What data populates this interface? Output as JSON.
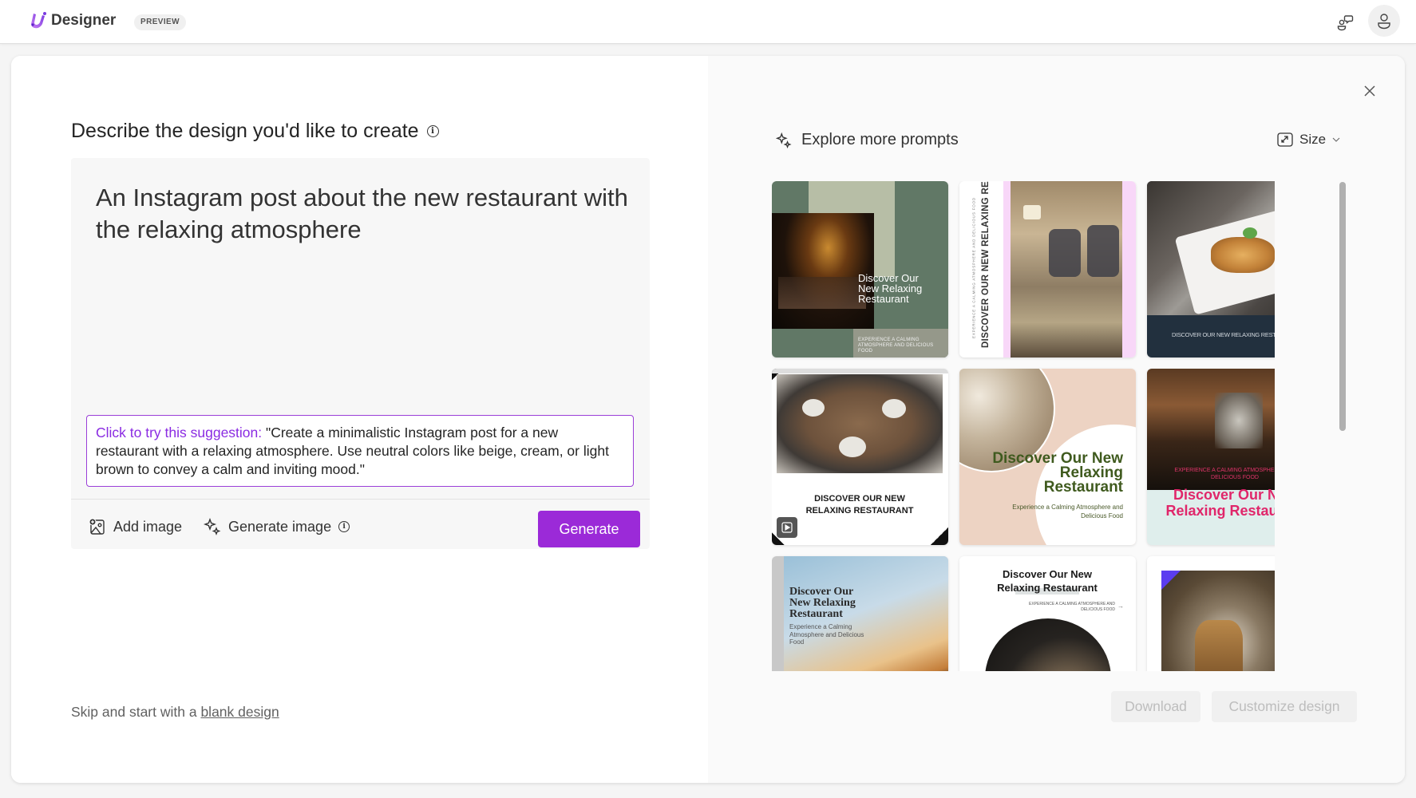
{
  "app": {
    "brand": "Designer",
    "badge": "PREVIEW",
    "accent_color": "#9b2ad8"
  },
  "topbar": {
    "feedback_icon": "feedback-people-icon",
    "account_icon": "person-icon"
  },
  "left": {
    "title": "Describe the design you'd like to create",
    "prompt_value": "An Instagram post about the new restaurant with the relaxing atmosphere",
    "suggestion_lead": "Click to try this suggestion:",
    "suggestion_text": " \"Create a minimalistic Instagram post for a new restaurant with a relaxing atmosphere. Use neutral colors like beige, cream, or light brown to convey a calm and inviting mood.\"",
    "add_image_label": "Add image",
    "generate_image_label": "Generate image",
    "generate_button": "Generate",
    "skip_text": "Skip and start with a ",
    "skip_link": "blank design"
  },
  "right": {
    "explore_label": "Explore more prompts",
    "size_label": "Size",
    "download_label": "Download",
    "customize_label": "Customize design",
    "thumbnails": [
      {
        "title": "Discover Our New Relaxing Restaurant",
        "subtitle": "EXPERIENCE A CALMING ATMOSPHERE AND DELICIOUS FOOD",
        "style": "green-blocks"
      },
      {
        "title": "DISCOVER OUR NEW RELAXING RESTAURANT",
        "subtitle": "EXPERIENCE A CALMING ATMOSPHERE AND DELICIOUS FOOD",
        "style": "pink-armchair"
      },
      {
        "title": "DISCOVER OUR NEW RELAXING RESTAURANT",
        "subtitle": "",
        "style": "navy-plate"
      },
      {
        "title": "DISCOVER OUR NEW RELAXING RESTAURANT",
        "subtitle": "",
        "style": "white-table-video"
      },
      {
        "title": "Discover Our New Relaxing Restaurant",
        "subtitle": "Experience a Calming Atmosphere and Delicious Food",
        "style": "peach-circle"
      },
      {
        "title": "Discover Our New Relaxing Restaurant",
        "subtitle": "EXPERIENCE A CALMING ATMOSPHERE AND DELICIOUS FOOD",
        "style": "mint-hall"
      },
      {
        "title": "Discover Our New Relaxing Restaurant",
        "subtitle": "Experience a Calming Atmosphere and Delicious Food",
        "style": "serif-sunset"
      },
      {
        "title": "Discover Our New Relaxing Restaurant",
        "subtitle": "EXPERIENCE A CALMING ATMOSPHERE AND DELICIOUS FOOD",
        "style": "white-oval"
      },
      {
        "title": "",
        "subtitle": "",
        "style": "food-photo-purple"
      }
    ]
  }
}
